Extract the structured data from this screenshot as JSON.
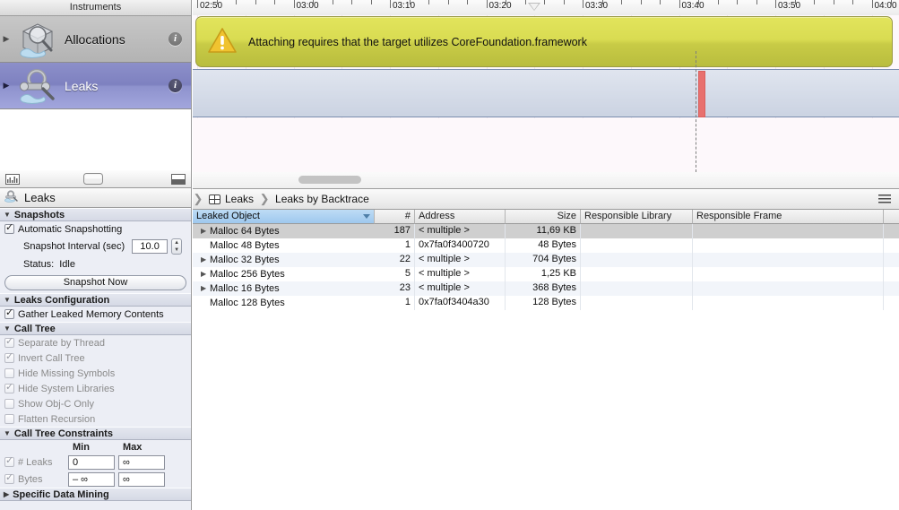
{
  "instruments_panel": {
    "header": "Instruments",
    "items": [
      {
        "label": "Allocations",
        "icon": "allocations-icon",
        "info": "i",
        "selected": false
      },
      {
        "label": "Leaks",
        "icon": "leaks-icon",
        "info": "i",
        "selected": true
      }
    ],
    "strip": {
      "left_icon": "mini-graph-icon",
      "mid_icon": "track-height-icon",
      "right_icon": "detail-pane-icon"
    }
  },
  "settings": {
    "title": "Leaks",
    "title_icon": "leaks-icon",
    "sections": {
      "snapshots": {
        "header": "Snapshots",
        "automatic_label": "Automatic Snapshotting",
        "automatic_checked": true,
        "interval_label": "Snapshot Interval (sec)",
        "interval_value": "10.0",
        "status_label": "Status:",
        "status_value": "Idle",
        "snapshot_now": "Snapshot Now"
      },
      "leaks_configuration": {
        "header": "Leaks Configuration",
        "gather_label": "Gather Leaked Memory Contents",
        "gather_checked": true
      },
      "call_tree": {
        "header": "Call Tree",
        "options": [
          {
            "label": "Separate by Thread",
            "checked": true
          },
          {
            "label": "Invert Call Tree",
            "checked": true
          },
          {
            "label": "Hide Missing Symbols",
            "checked": false
          },
          {
            "label": "Hide System Libraries",
            "checked": true
          },
          {
            "label": "Show Obj-C Only",
            "checked": false
          },
          {
            "label": "Flatten Recursion",
            "checked": false
          }
        ]
      },
      "call_tree_constraints": {
        "header": "Call Tree Constraints",
        "col_min": "Min",
        "col_max": "Max",
        "rows": [
          {
            "label": "# Leaks",
            "checked": true,
            "min": "0",
            "max": "∞"
          },
          {
            "label": "Bytes",
            "checked": true,
            "min": "– ∞",
            "max": "∞"
          }
        ]
      },
      "specific_data_mining": {
        "header": "Specific Data Mining",
        "expanded": false
      }
    }
  },
  "timeline": {
    "ruler_labels": [
      "02:50",
      "03:00",
      "03:10",
      "03:20",
      "03:30",
      "03:40",
      "03:50",
      "04:00"
    ],
    "banner": {
      "icon": "warning-triangle-icon",
      "text": "Attaching requires that the target utilizes CoreFoundation.framework"
    },
    "leak_marker_color": "#e8706e",
    "track_color": "#cbd3e2"
  },
  "detail_bar": {
    "crumbs": [
      {
        "label": "Leaks",
        "icon": "grid-icon"
      },
      {
        "label": "Leaks by Backtrace",
        "icon": null
      }
    ],
    "menu_icon": "hamburger-icon"
  },
  "table": {
    "columns": [
      {
        "key": "object",
        "label": "Leaked Object",
        "sorted": true
      },
      {
        "key": "count",
        "label": "#",
        "sorted": false
      },
      {
        "key": "address",
        "label": "Address",
        "sorted": false
      },
      {
        "key": "size",
        "label": "Size",
        "sorted": false
      },
      {
        "key": "library",
        "label": "Responsible Library",
        "sorted": false
      },
      {
        "key": "frame",
        "label": "Responsible Frame",
        "sorted": false
      }
    ],
    "rows": [
      {
        "object": "Malloc 64 Bytes",
        "expandable": true,
        "count": "187",
        "address": "< multiple >",
        "size": "11,69 KB",
        "library": "",
        "frame": "",
        "selected": true
      },
      {
        "object": "Malloc 48 Bytes",
        "expandable": false,
        "count": "1",
        "address": "0x7fa0f3400720",
        "size": "48 Bytes",
        "library": "",
        "frame": "",
        "selected": false
      },
      {
        "object": "Malloc 32 Bytes",
        "expandable": true,
        "count": "22",
        "address": "< multiple >",
        "size": "704 Bytes",
        "library": "",
        "frame": "",
        "selected": false
      },
      {
        "object": "Malloc 256 Bytes",
        "expandable": true,
        "count": "5",
        "address": "< multiple >",
        "size": "1,25 KB",
        "library": "",
        "frame": "",
        "selected": false
      },
      {
        "object": "Malloc 16 Bytes",
        "expandable": true,
        "count": "23",
        "address": "< multiple >",
        "size": "368 Bytes",
        "library": "",
        "frame": "",
        "selected": false
      },
      {
        "object": "Malloc 128 Bytes",
        "expandable": false,
        "count": "1",
        "address": "0x7fa0f3404a30",
        "size": "128 Bytes",
        "library": "",
        "frame": "",
        "selected": false
      }
    ]
  }
}
